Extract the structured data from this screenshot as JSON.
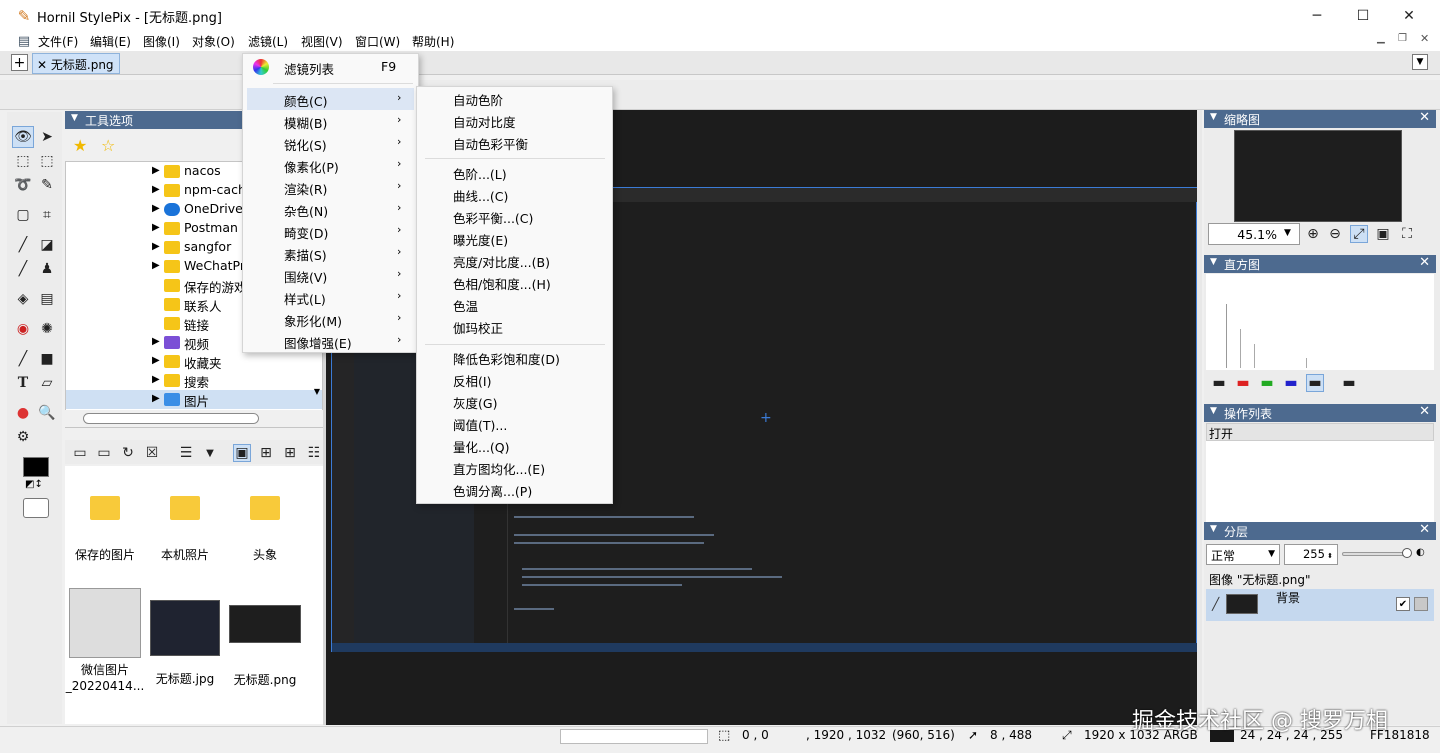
{
  "window": {
    "title": "Hornil StylePix - [无标题.png]",
    "minimize": "─",
    "maximize": "☐",
    "close": "✕"
  },
  "menu": {
    "items": [
      "文件(F)",
      "编辑(E)",
      "图像(I)",
      "对象(O)",
      "滤镜(L)",
      "视图(V)",
      "窗口(W)",
      "帮助(H)"
    ]
  },
  "tab": {
    "label": "无标题.png",
    "close": "✕",
    "add": "+"
  },
  "panels": {
    "tool_options": "工具选项",
    "thumbnail": "缩略图",
    "histogram": "直方图",
    "history": "操作列表",
    "layers": "分层"
  },
  "tree": [
    "nacos",
    "npm-cache",
    "OneDrive",
    "Postman",
    "sangfor",
    "WeChatPro",
    "保存的游戏",
    "联系人",
    "链接",
    "视频",
    "收藏夹",
    "搜索",
    "图片"
  ],
  "files": [
    {
      "name": "保存的图片",
      "kind": "folder"
    },
    {
      "name": "本机照片",
      "kind": "folder"
    },
    {
      "name": "头象",
      "kind": "folder"
    },
    {
      "name": "微信图片_20220414...",
      "kind": "image"
    },
    {
      "name": "无标题.jpg",
      "kind": "image"
    },
    {
      "name": "无标题.png",
      "kind": "image"
    }
  ],
  "thumbnail": {
    "zoom": "45.1%"
  },
  "history": {
    "items": [
      "打开"
    ]
  },
  "layers": {
    "blend": "正常",
    "opacity": "255",
    "image_label": "图像 \"无标题.png\"",
    "layer_name": "背景"
  },
  "filter_menu": {
    "header": "滤镜列表",
    "header_shortcut": "F9",
    "items": [
      "颜色(C)",
      "模糊(B)",
      "锐化(S)",
      "像素化(P)",
      "渲染(R)",
      "杂色(N)",
      "畸变(D)",
      "素描(S)",
      "围绕(V)",
      "样式(L)",
      "象形化(M)",
      "图像增强(E)"
    ]
  },
  "color_menu": {
    "group1": [
      "自动色阶",
      "自动对比度",
      "自动色彩平衡"
    ],
    "group2": [
      "色阶...(L)",
      "曲线...(C)",
      "色彩平衡...(C)",
      "曝光度(E)",
      "亮度/对比度...(B)",
      "色相/饱和度...(H)",
      "色温",
      "伽玛校正"
    ],
    "group3": [
      "降低色彩饱和度(D)",
      "反相(I)",
      "灰度(G)",
      "阈值(T)...",
      "量化...(Q)",
      "直方图均化...(E)",
      "色调分离...(P)"
    ]
  },
  "status": {
    "pos": "0 , 0",
    "size": ", 1920 , 1032",
    "center": "(960, 516)",
    "cursor": "8 , 488",
    "dims": "1920 x 1032 ARGB",
    "rgba": "24 , 24 , 24 , 255",
    "hex": "FF181818"
  },
  "watermark": "掘金技术社区 @ 搜罗万相",
  "colors": {
    "panel_title": "#4d6a8f",
    "menu_hover": "#dce6f4",
    "accent": "#3b7bd6"
  }
}
